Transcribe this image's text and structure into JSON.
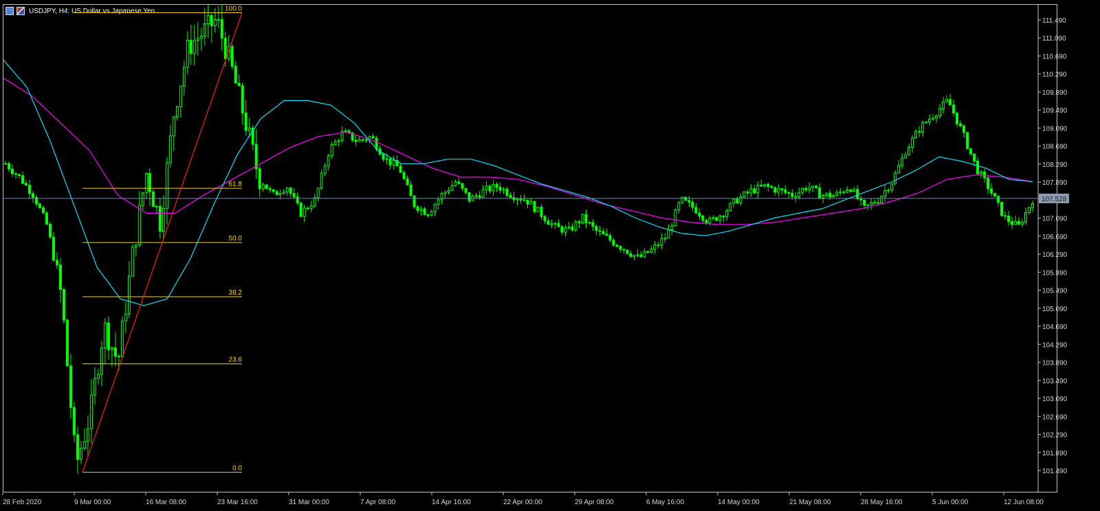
{
  "window": {
    "title": "USDJPY, H4:  US Dollar vs Japanese Yen",
    "symbol_icon": "symbol-icon",
    "flag_icon": "currency-flag-icon"
  },
  "colors": {
    "background": "#000000",
    "candle": "#00ff00",
    "fast_ma": "#00e5ff",
    "slow_ma": "#ff00ff",
    "fib_levels": "#ffd700",
    "trend_line": "#ff1a1a",
    "current_price_line": "#7a8ca8",
    "axis_text": "#d8d8d8"
  },
  "price_axis": {
    "labels": [
      "111.490",
      "111.090",
      "110.690",
      "110.290",
      "109.890",
      "109.490",
      "109.090",
      "108.690",
      "108.290",
      "107.890",
      "107.090",
      "106.690",
      "106.290",
      "105.890",
      "105.490",
      "105.090",
      "104.690",
      "104.290",
      "103.890",
      "103.490",
      "103.090",
      "102.690",
      "102.290",
      "101.890",
      "101.490"
    ],
    "current_price": "107.528"
  },
  "time_axis": {
    "labels": [
      "28 Feb 2020",
      "9 Mar 00:00",
      "16 Mar 08:00",
      "23 Mar 16:00",
      "31 Mar 00:00",
      "7 Apr 08:00",
      "14 Apr 16:00",
      "22 Apr 00:00",
      "29 Apr 08:00",
      "6 May 16:00",
      "14 May 00:00",
      "21 May 08:00",
      "28 May 16:00",
      "5 Jun 00:00",
      "12 Jun 08:00"
    ]
  },
  "fibonacci": {
    "levels": [
      "100.0",
      "61.8",
      "50.0",
      "38.2",
      "23.6",
      "0.0"
    ]
  },
  "chart_data": {
    "type": "candlestick",
    "symbol": "USDJPY",
    "timeframe": "H4",
    "y_range": [
      101.2,
      111.8
    ],
    "x": [
      "28 Feb",
      "2 Mar",
      "4 Mar",
      "6 Mar",
      "9 Mar",
      "10 Mar",
      "11 Mar",
      "12 Mar",
      "13 Mar",
      "16 Mar",
      "17 Mar",
      "18 Mar",
      "19 Mar",
      "20 Mar",
      "23 Mar",
      "24 Mar",
      "25 Mar",
      "26 Mar",
      "27 Mar",
      "30 Mar",
      "31 Mar",
      "1 Apr",
      "2 Apr",
      "3 Apr",
      "6 Apr",
      "7 Apr",
      "8 Apr",
      "9 Apr",
      "10 Apr",
      "13 Apr",
      "14 Apr",
      "15 Apr",
      "16 Apr",
      "17 Apr",
      "20 Apr",
      "21 Apr",
      "22 Apr",
      "23 Apr",
      "24 Apr",
      "27 Apr",
      "28 Apr",
      "29 Apr",
      "30 Apr",
      "1 May",
      "4 May",
      "5 May",
      "6 May",
      "7 May",
      "8 May",
      "11 May",
      "12 May",
      "13 May",
      "14 May",
      "15 May",
      "18 May",
      "19 May",
      "20 May",
      "21 May",
      "22 May",
      "25 May",
      "26 May",
      "27 May",
      "28 May",
      "29 May",
      "1 Jun",
      "2 Jun",
      "3 Jun",
      "4 Jun",
      "5 Jun",
      "8 Jun",
      "9 Jun",
      "10 Jun",
      "11 Jun",
      "12 Jun"
    ],
    "price_path": [
      108.3,
      108.0,
      107.6,
      106.9,
      105.3,
      101.6,
      102.7,
      104.7,
      103.9,
      106.2,
      108.1,
      107.0,
      109.5,
      110.9,
      111.2,
      111.5,
      110.5,
      109.3,
      108.0,
      107.6,
      107.8,
      107.2,
      107.5,
      108.6,
      109.0,
      108.8,
      108.9,
      108.4,
      108.2,
      107.4,
      107.2,
      107.6,
      107.9,
      107.5,
      107.7,
      107.8,
      107.6,
      107.5,
      107.2,
      106.9,
      106.8,
      107.1,
      106.8,
      106.6,
      106.4,
      106.2,
      106.4,
      106.7,
      107.5,
      107.3,
      107.0,
      107.2,
      107.5,
      107.7,
      107.8,
      107.7,
      107.6,
      107.8,
      107.6,
      107.6,
      107.8,
      107.3,
      107.5,
      107.9,
      108.6,
      109.1,
      109.4,
      109.7,
      109.0,
      108.2,
      107.7,
      107.1,
      106.9,
      107.5
    ],
    "fast_ma": [
      110.6,
      110.0,
      108.8,
      107.4,
      106.0,
      105.3,
      105.15,
      105.3,
      106.2,
      107.4,
      108.5,
      109.3,
      109.7,
      109.7,
      109.6,
      109.2,
      108.6,
      108.3,
      108.3,
      108.4,
      108.4,
      108.25,
      108.05,
      107.85,
      107.7,
      107.55,
      107.35,
      107.1,
      106.9,
      106.75,
      106.7,
      106.8,
      106.95,
      107.1,
      107.2,
      107.3,
      107.5,
      107.7,
      107.9,
      108.15,
      108.45,
      108.35,
      108.2,
      107.95,
      107.9
    ],
    "slow_ma": [
      110.2,
      109.8,
      109.2,
      108.6,
      107.6,
      107.2,
      107.2,
      107.6,
      107.95,
      108.3,
      108.65,
      108.9,
      109.0,
      108.8,
      108.5,
      108.2,
      108.0,
      108.0,
      107.95,
      107.8,
      107.6,
      107.4,
      107.25,
      107.1,
      107.0,
      106.95,
      106.95,
      107.0,
      107.1,
      107.2,
      107.3,
      107.45,
      107.65,
      107.95,
      108.05,
      108.0,
      107.9
    ],
    "fib_anchor_low": 101.45,
    "fib_anchor_high": 111.65
  }
}
